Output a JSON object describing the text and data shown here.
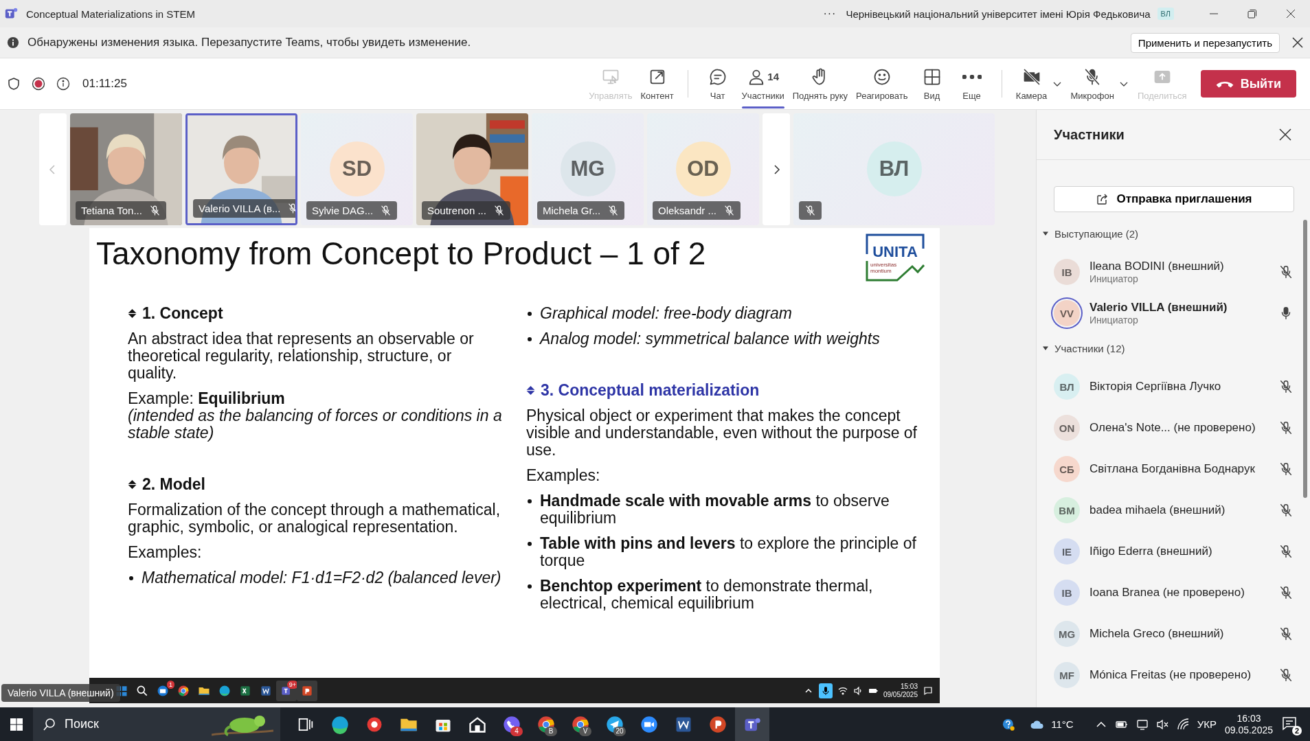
{
  "window": {
    "title": "Conceptual Materializations in STEM",
    "more": "···",
    "organization": "Чернівецький національний університет імені Юрія Федьковича",
    "user_initials": "ВЛ"
  },
  "notification": {
    "text": "Обнаружены изменения языка. Перезапустите Teams, чтобы увидеть изменение.",
    "button": "Применить и перезапустить"
  },
  "call": {
    "timer": "01:11:25",
    "leave": "Выйти",
    "toolbar": [
      {
        "label": "Управлять",
        "disabled": true,
        "selected": false
      },
      {
        "label": "Контент",
        "disabled": false,
        "selected": false
      },
      {
        "label": "Чат",
        "disabled": false,
        "selected": false
      },
      {
        "label": "Участники",
        "count": "14",
        "disabled": false,
        "selected": true
      },
      {
        "label": "Поднять руку",
        "disabled": false,
        "selected": false
      },
      {
        "label": "Реагировать",
        "disabled": false,
        "selected": false
      },
      {
        "label": "Вид",
        "disabled": false,
        "selected": false
      },
      {
        "label": "Еще",
        "disabled": false,
        "selected": false
      },
      {
        "label": "Камера",
        "dropdown": true,
        "disabled": false,
        "selected": false
      },
      {
        "label": "Микрофон",
        "dropdown": true,
        "disabled": false,
        "selected": false
      },
      {
        "label": "Поделиться",
        "disabled": true,
        "selected": false
      }
    ]
  },
  "video_strip": {
    "tiles": [
      {
        "kind": "video",
        "name": "Tetiana Ton...",
        "speaking": false
      },
      {
        "kind": "video",
        "name": "Valerio VILLA (в...",
        "speaking": true
      },
      {
        "kind": "avatar",
        "initials": "SD",
        "name": "Sylvie DAG...",
        "color": "#fbe2cc",
        "speaking": false
      },
      {
        "kind": "video",
        "name": "Soutrenon ...",
        "speaking": false
      },
      {
        "kind": "avatar",
        "initials": "MG",
        "name": "Michela Gr...",
        "color": "#dde6eb",
        "speaking": false
      },
      {
        "kind": "avatar",
        "initials": "OD",
        "name": "Oleksandr ...",
        "color": "#fbe6c2",
        "speaking": false
      },
      {
        "kind": "avatar",
        "initials": "ВЛ",
        "color": "#d6eeee",
        "speaking": false
      }
    ]
  },
  "slide": {
    "title": "Taxonomy from Concept to Product – 1 of 2",
    "logo": {
      "name": "UNITA",
      "line_1": "universitas",
      "line_2": "montium"
    },
    "columns": [
      [
        {
          "kind": "heading",
          "text": "1. Concept",
          "highlighted": false
        },
        {
          "kind": "paragraph",
          "text": "An abstract idea that represents an observable or theoretical regularity, relationship, structure, or quality.",
          "italic": false
        },
        {
          "kind": "paragraph",
          "text": "Example: **Equilibrium**",
          "italic": false
        },
        {
          "kind": "note",
          "text": "(intended as the balancing of forces or conditions in a stable state)",
          "italic": true
        },
        {
          "kind": "heading",
          "text": "2. Model",
          "highlighted": false
        },
        {
          "kind": "paragraph",
          "text": "Formalization of the concept through a mathematical, graphic, symbolic, or analogical representation.",
          "italic": false
        },
        {
          "kind": "paragraph",
          "text": "Examples:",
          "italic": false
        },
        {
          "kind": "bullet",
          "text": "Mathematical model: F1·d1=F2·d2 (balanced lever)",
          "italic": true
        }
      ],
      [
        {
          "kind": "bullet",
          "text": "Graphical model: free-body diagram",
          "italic": true
        },
        {
          "kind": "bullet",
          "text": "Analog model: symmetrical balance with weights",
          "italic": true
        },
        {
          "kind": "heading",
          "text": "3. Conceptual materialization",
          "highlighted": true
        },
        {
          "kind": "paragraph",
          "text": "Physical object or experiment that makes the concept visible and understandable, even without the purpose of use.",
          "italic": false
        },
        {
          "kind": "paragraph",
          "text": "Examples:",
          "italic": false
        },
        {
          "kind": "bullet",
          "text": "**Handmade scale with movable arms** to observe equilibrium",
          "italic": false
        },
        {
          "kind": "bullet",
          "text": "**Table with pins and levers** to explore the principle of torque",
          "italic": false
        },
        {
          "kind": "bullet",
          "text": "**Benchtop experiment** to demonstrate thermal, electrical, chemical equilibrium",
          "italic": false
        }
      ]
    ]
  },
  "shared_taskbar": {
    "presenter": "Valerio VILLA (внешний)",
    "apps": [
      {
        "active": false
      },
      {
        "active": false
      },
      {
        "active": false,
        "badge": "1"
      },
      {
        "active": false
      },
      {
        "active": false
      },
      {
        "active": false
      },
      {
        "active": false
      },
      {
        "active": false
      },
      {
        "active": true,
        "badge": "9+"
      },
      {
        "active": true
      }
    ],
    "time": "15:03",
    "date": "09/05/2025"
  },
  "participants_panel": {
    "title": "Участники",
    "invite_button": "Отправка приглашения",
    "groups": [
      {
        "label": "Выступающие (2)",
        "expanded": true,
        "people": [
          {
            "initials": "IB",
            "name": "Ileana BODINI (внешний)",
            "role": "Инициатор",
            "color": "#eadcd7",
            "muted": true,
            "speaking": false
          },
          {
            "initials": "VV",
            "name": "Valerio VILLA (внешний)",
            "role": "Инициатор",
            "color": "#f3d3c6",
            "muted": false,
            "speaking": true
          }
        ]
      },
      {
        "label": "Участники (12)",
        "expanded": true,
        "people": [
          {
            "initials": "ВЛ",
            "name": "Вікторія Сергіївна Лучко",
            "color": "#d8eff1",
            "muted": true,
            "speaking": false
          },
          {
            "initials": "ON",
            "name": "Олена's Note...  (не проверено)",
            "color": "#ece0dc",
            "muted": true,
            "speaking": false
          },
          {
            "initials": "СБ",
            "name": "Світлана Богданівна Боднарук",
            "color": "#f6d8cd",
            "muted": true,
            "speaking": false
          },
          {
            "initials": "BM",
            "name": "badea mihaela (внешний)",
            "color": "#d7efdf",
            "muted": true,
            "speaking": false
          },
          {
            "initials": "IE",
            "name": "Iñigo Ederra (внешний)",
            "color": "#d5ddf1",
            "muted": true,
            "speaking": false
          },
          {
            "initials": "IB",
            "name": "Ioana Branea (не проверено)",
            "color": "#d5ddf1",
            "muted": true,
            "speaking": false
          },
          {
            "initials": "MG",
            "name": "Michela Greco (внешний)",
            "color": "#dde6ec",
            "muted": true,
            "speaking": false
          },
          {
            "initials": "MF",
            "name": "Mónica Freitas (не проверено)",
            "color": "#dde6ec",
            "muted": true,
            "speaking": false
          }
        ]
      }
    ]
  },
  "taskbar": {
    "search": "Поиск",
    "apps": [
      {
        "active": false
      },
      {
        "active": false
      },
      {
        "active": false
      },
      {
        "active": false
      },
      {
        "active": false
      },
      {
        "active": false
      },
      {
        "active": false,
        "badge": "4"
      },
      {
        "active": false,
        "badge": "B"
      },
      {
        "active": false,
        "badge": "V"
      },
      {
        "active": false,
        "badge": "20"
      },
      {
        "active": false
      },
      {
        "active": false
      },
      {
        "active": false
      },
      {
        "active": true
      }
    ],
    "temperature": "11°C",
    "language": "УКР",
    "time": "16:03",
    "date": "09.05.2025",
    "notifications": "2"
  }
}
